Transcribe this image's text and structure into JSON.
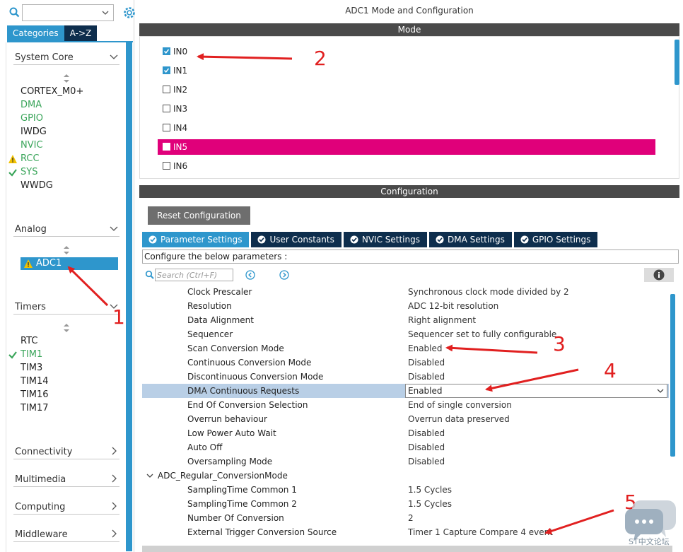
{
  "left": {
    "tabs": {
      "categories": "Categories",
      "az": "A->Z"
    },
    "sections": [
      {
        "label": "System Core",
        "expanded": true
      },
      {
        "label": "Analog",
        "expanded": true
      },
      {
        "label": "Timers",
        "expanded": true
      },
      {
        "label": "Connectivity",
        "expanded": false
      },
      {
        "label": "Multimedia",
        "expanded": false
      },
      {
        "label": "Computing",
        "expanded": false
      },
      {
        "label": "Middleware",
        "expanded": false
      }
    ],
    "system_core_items": [
      "CORTEX_M0+",
      "DMA",
      "GPIO",
      "IWDG",
      "NVIC",
      "RCC",
      "SYS",
      "WWDG"
    ],
    "analog_items": [
      "ADC1"
    ],
    "timer_items": [
      "RTC",
      "TIM1",
      "TIM3",
      "TIM14",
      "TIM16",
      "TIM17"
    ]
  },
  "right": {
    "title": "ADC1 Mode and Configuration",
    "mode_bar": "Mode",
    "mode_inputs": [
      {
        "label": "IN0",
        "checked": true
      },
      {
        "label": "IN1",
        "checked": true
      },
      {
        "label": "IN2",
        "checked": false
      },
      {
        "label": "IN3",
        "checked": false
      },
      {
        "label": "IN4",
        "checked": false
      },
      {
        "label": "IN5",
        "checked": false
      },
      {
        "label": "IN6",
        "checked": false
      }
    ],
    "config_bar": "Configuration",
    "reset_button": "Reset Configuration",
    "param_tabs": [
      "Parameter Settings",
      "User Constants",
      "NVIC Settings",
      "DMA Settings",
      "GPIO Settings"
    ],
    "configure_hint": "Configure the below parameters :",
    "search_placeholder": "Search (Ctrl+F)",
    "params": [
      {
        "name": "Clock Prescaler",
        "value": "Synchronous clock mode divided by 2"
      },
      {
        "name": "Resolution",
        "value": "ADC 12-bit resolution"
      },
      {
        "name": "Data Alignment",
        "value": "Right alignment"
      },
      {
        "name": "Sequencer",
        "value": "Sequencer set to fully configurable"
      },
      {
        "name": "Scan Conversion Mode",
        "value": "Enabled"
      },
      {
        "name": "Continuous Conversion Mode",
        "value": "Disabled"
      },
      {
        "name": "Discontinuous Conversion Mode",
        "value": "Disabled"
      },
      {
        "name": "DMA Continuous Requests",
        "value": "Enabled"
      },
      {
        "name": "End Of Conversion Selection",
        "value": "End of single conversion"
      },
      {
        "name": "Overrun behaviour",
        "value": "Overrun data preserved"
      },
      {
        "name": "Low Power Auto Wait",
        "value": "Disabled"
      },
      {
        "name": "Auto Off",
        "value": "Disabled"
      },
      {
        "name": "Oversampling Mode",
        "value": "Disabled"
      },
      {
        "name": "ADC_Regular_ConversionMode",
        "value": ""
      },
      {
        "name": "SamplingTime Common 1",
        "value": "1.5 Cycles"
      },
      {
        "name": "SamplingTime Common 2",
        "value": "1.5 Cycles"
      },
      {
        "name": "Number Of Conversion",
        "value": "2"
      },
      {
        "name": "External Trigger Conversion Source",
        "value": "Timer 1 Capture Compare 4 event"
      }
    ]
  },
  "annotations": [
    "1",
    "2",
    "3",
    "4",
    "5"
  ],
  "watermark": {
    "text": "ST中文论坛"
  },
  "colors": {
    "accent": "#2e96cc",
    "dark_tab": "#0e2e4d",
    "highlight": "#e0007a",
    "annotation": "#e12020",
    "ok_green": "#3aa55a",
    "warning": "#f2c200"
  }
}
